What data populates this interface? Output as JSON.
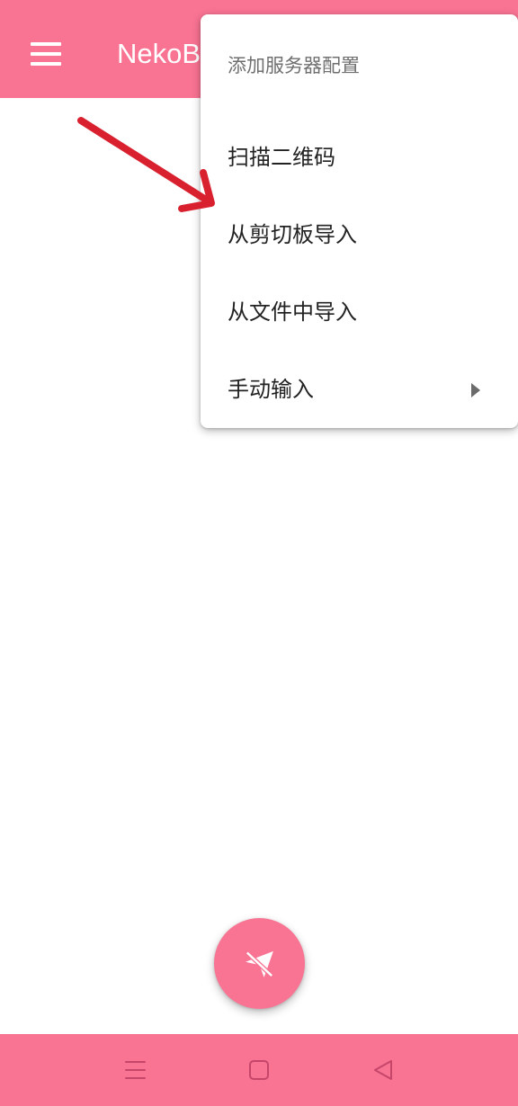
{
  "app_bar": {
    "title": "NekoB",
    "menu_icon": "hamburger-menu-icon",
    "color": "#f97393"
  },
  "popup_menu": {
    "header": "添加服务器配置",
    "items": [
      {
        "label": "扫描二维码"
      },
      {
        "label": "从剪切板导入"
      },
      {
        "label": "从文件中导入"
      },
      {
        "label": "手动输入",
        "has_submenu": true
      }
    ]
  },
  "annotation": {
    "arrow_color": "#d9202f",
    "points_to": "从剪切板导入"
  },
  "fab": {
    "icon": "paper-plane-off-icon",
    "color": "#f97393"
  },
  "nav_bar": {
    "buttons": [
      "recents-icon",
      "home-icon",
      "back-icon"
    ],
    "color": "#f97393"
  }
}
